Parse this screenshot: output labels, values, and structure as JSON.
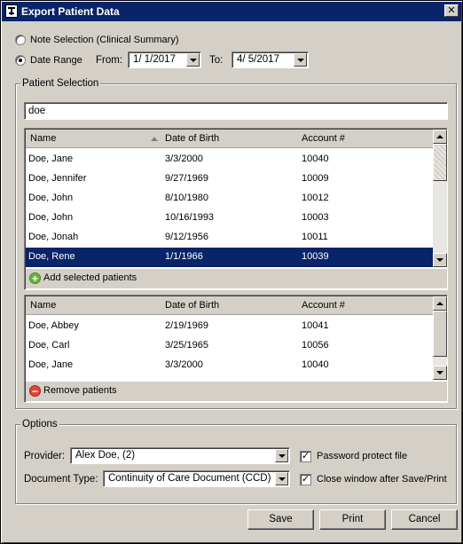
{
  "window": {
    "title": "Export Patient Data"
  },
  "export_mode": {
    "note_selection_label": "Note Selection (Clinical Summary)",
    "date_range_label": "Date Range",
    "selected": "date_range",
    "from_label": "From:",
    "from_value": "1/  1/2017",
    "to_label": "To:",
    "to_value": "4/  5/2017"
  },
  "patient_selection": {
    "group_label": "Patient Selection",
    "search_value": "doe",
    "columns": [
      "Name",
      "Date of Birth",
      "Account #"
    ],
    "results": [
      {
        "name": "Doe, Jane",
        "dob": "3/3/2000",
        "account": "10040"
      },
      {
        "name": "Doe, Jennifer",
        "dob": "9/27/1969",
        "account": "10009"
      },
      {
        "name": "Doe, John",
        "dob": "8/10/1980",
        "account": "10012"
      },
      {
        "name": "Doe, John",
        "dob": "10/16/1993",
        "account": "10003"
      },
      {
        "name": "Doe, Jonah",
        "dob": "9/12/1956",
        "account": "10011"
      },
      {
        "name": "Doe, Rene",
        "dob": "1/1/1966",
        "account": "10039"
      }
    ],
    "selected_result_index": 5,
    "add_label": "Add selected patients",
    "selected_patients": [
      {
        "name": "Doe, Abbey",
        "dob": "2/19/1969",
        "account": "10041"
      },
      {
        "name": "Doe, Carl",
        "dob": "3/25/1965",
        "account": "10056"
      },
      {
        "name": "Doe, Jane",
        "dob": "3/3/2000",
        "account": "10040"
      }
    ],
    "remove_label": "Remove patients"
  },
  "options": {
    "group_label": "Options",
    "provider_label": "Provider:",
    "provider_value": "Alex  Doe,  (2)",
    "document_type_label": "Document Type:",
    "document_type_value": "Continuity of Care Document (CCD)",
    "password_protect_label": "Password protect file",
    "password_protect_checked": true,
    "close_window_label": "Close window after Save/Print",
    "close_window_checked": true
  },
  "buttons": {
    "save": "Save",
    "print": "Print",
    "cancel": "Cancel"
  },
  "colors": {
    "titlebar": "#0a246a",
    "selection": "#0a246a",
    "face": "#d4d0c8",
    "add_icon": "#6cb33f",
    "remove_icon": "#e0453c"
  },
  "icons": {
    "add": "plus-circle-icon",
    "remove": "minus-circle-icon",
    "sort": "sort-ascending-icon"
  }
}
